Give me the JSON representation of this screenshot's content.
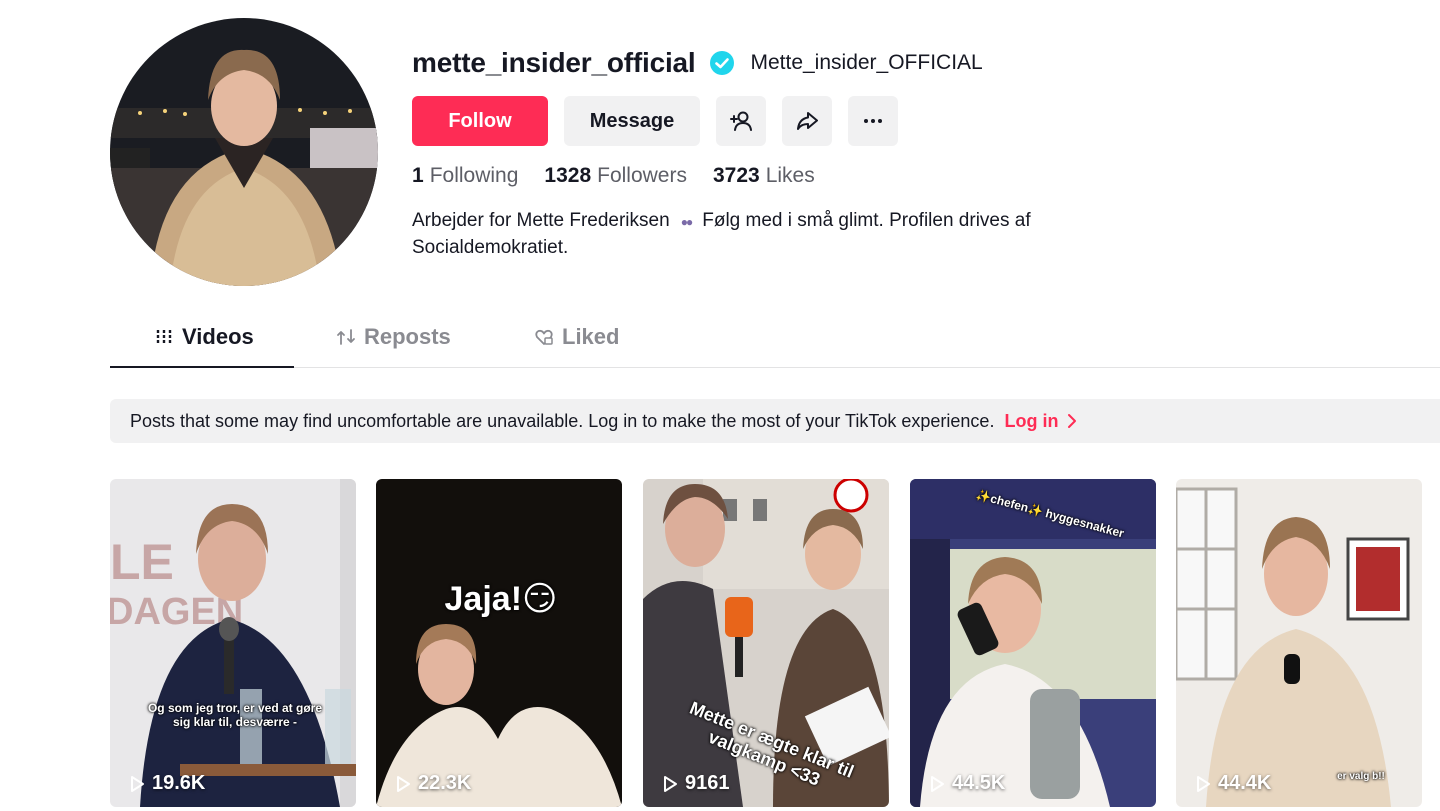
{
  "profile": {
    "username": "mette_insider_official",
    "nickname": "Mette_insider_OFFICIAL",
    "verified": true,
    "bio_part1": "Arbejder for Mette Frederiksen",
    "bio_part2": "Følg med i små glimt. Profilen drives af Socialdemokratiet.",
    "bio_emoji": "eyes"
  },
  "buttons": {
    "follow": "Follow",
    "message": "Message"
  },
  "stats": {
    "following": {
      "value": "1",
      "label": "Following"
    },
    "followers": {
      "value": "1328",
      "label": "Followers"
    },
    "likes": {
      "value": "3723",
      "label": "Likes"
    }
  },
  "tabs": {
    "videos": "Videos",
    "reposts": "Reposts",
    "liked": "Liked"
  },
  "notice": {
    "text": "Posts that some may find uncomfortable are unavailable. Log in to make the most of your TikTok experience.",
    "login": "Log in"
  },
  "videos": [
    {
      "views": "19.6K",
      "caption": "Og som jeg tror, er ved at gøre sig klar til, desværre -"
    },
    {
      "views": "22.3K",
      "caption": "Jaja!😏"
    },
    {
      "views": "9161",
      "caption": "Mette er ægte klar til valgkamp <33"
    },
    {
      "views": "44.5K",
      "caption": "✨chefen✨ hyggesnakker"
    },
    {
      "views": "44.4K",
      "caption": "er valg b!!"
    }
  ],
  "colors": {
    "accent": "#fe2c55",
    "verified": "#20d5ec",
    "text": "#161823",
    "muted": "#8a8b91",
    "button_bg": "#f1f1f2"
  }
}
